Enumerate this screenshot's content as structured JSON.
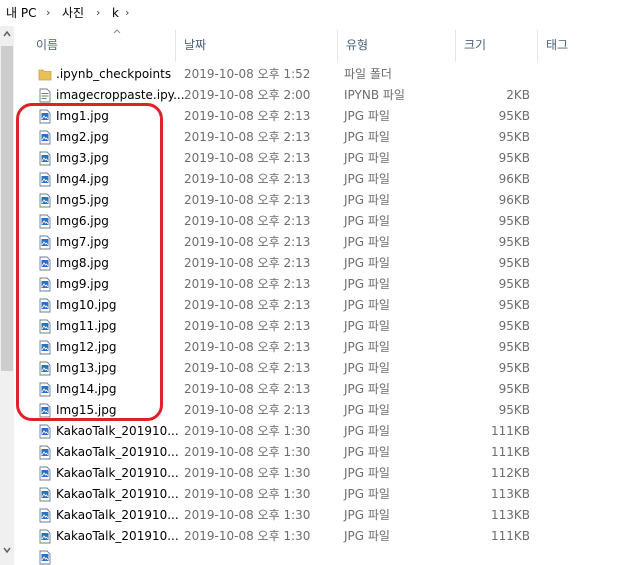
{
  "breadcrumb": [
    "내 PC",
    "사진",
    "k"
  ],
  "columns": {
    "name": "이름",
    "date": "날짜",
    "type": "유형",
    "size": "크기",
    "tags": "태그"
  },
  "files": [
    {
      "name": ".ipynb_checkpoints",
      "date": "2019-10-08 오후 1:52",
      "type": "파일 폴더",
      "size": "",
      "icon": "folder-icon"
    },
    {
      "name": "imagecroppaste.ipy...",
      "date": "2019-10-08 오후 2:00",
      "type": "IPYNB 파일",
      "size": "2KB",
      "icon": "document-icon"
    },
    {
      "name": "Img1.jpg",
      "date": "2019-10-08 오후 2:13",
      "type": "JPG 파일",
      "size": "95KB",
      "icon": "image-file-icon"
    },
    {
      "name": "Img2.jpg",
      "date": "2019-10-08 오후 2:13",
      "type": "JPG 파일",
      "size": "95KB",
      "icon": "image-file-icon"
    },
    {
      "name": "Img3.jpg",
      "date": "2019-10-08 오후 2:13",
      "type": "JPG 파일",
      "size": "95KB",
      "icon": "image-file-icon"
    },
    {
      "name": "Img4.jpg",
      "date": "2019-10-08 오후 2:13",
      "type": "JPG 파일",
      "size": "96KB",
      "icon": "image-file-icon"
    },
    {
      "name": "Img5.jpg",
      "date": "2019-10-08 오후 2:13",
      "type": "JPG 파일",
      "size": "96KB",
      "icon": "image-file-icon"
    },
    {
      "name": "Img6.jpg",
      "date": "2019-10-08 오후 2:13",
      "type": "JPG 파일",
      "size": "95KB",
      "icon": "image-file-icon"
    },
    {
      "name": "Img7.jpg",
      "date": "2019-10-08 오후 2:13",
      "type": "JPG 파일",
      "size": "95KB",
      "icon": "image-file-icon"
    },
    {
      "name": "Img8.jpg",
      "date": "2019-10-08 오후 2:13",
      "type": "JPG 파일",
      "size": "95KB",
      "icon": "image-file-icon"
    },
    {
      "name": "Img9.jpg",
      "date": "2019-10-08 오후 2:13",
      "type": "JPG 파일",
      "size": "95KB",
      "icon": "image-file-icon"
    },
    {
      "name": "Img10.jpg",
      "date": "2019-10-08 오후 2:13",
      "type": "JPG 파일",
      "size": "95KB",
      "icon": "image-file-icon"
    },
    {
      "name": "Img11.jpg",
      "date": "2019-10-08 오후 2:13",
      "type": "JPG 파일",
      "size": "95KB",
      "icon": "image-file-icon"
    },
    {
      "name": "Img12.jpg",
      "date": "2019-10-08 오후 2:13",
      "type": "JPG 파일",
      "size": "95KB",
      "icon": "image-file-icon"
    },
    {
      "name": "Img13.jpg",
      "date": "2019-10-08 오후 2:13",
      "type": "JPG 파일",
      "size": "95KB",
      "icon": "image-file-icon"
    },
    {
      "name": "Img14.jpg",
      "date": "2019-10-08 오후 2:13",
      "type": "JPG 파일",
      "size": "95KB",
      "icon": "image-file-icon"
    },
    {
      "name": "Img15.jpg",
      "date": "2019-10-08 오후 2:13",
      "type": "JPG 파일",
      "size": "95KB",
      "icon": "image-file-icon"
    },
    {
      "name": "KakaoTalk_201910...",
      "date": "2019-10-08 오후 1:30",
      "type": "JPG 파일",
      "size": "111KB",
      "icon": "image-file-icon"
    },
    {
      "name": "KakaoTalk_201910...",
      "date": "2019-10-08 오후 1:30",
      "type": "JPG 파일",
      "size": "111KB",
      "icon": "image-file-icon"
    },
    {
      "name": "KakaoTalk_201910...",
      "date": "2019-10-08 오후 1:30",
      "type": "JPG 파일",
      "size": "112KB",
      "icon": "image-file-icon"
    },
    {
      "name": "KakaoTalk_201910...",
      "date": "2019-10-08 오후 1:30",
      "type": "JPG 파일",
      "size": "113KB",
      "icon": "image-file-icon"
    },
    {
      "name": "KakaoTalk_201910...",
      "date": "2019-10-08 오후 1:30",
      "type": "JPG 파일",
      "size": "113KB",
      "icon": "image-file-icon"
    },
    {
      "name": "KakaoTalk_201910...",
      "date": "2019-10-08 오후 1:30",
      "type": "JPG 파일",
      "size": "111KB",
      "icon": "image-file-icon"
    },
    {
      "name": "",
      "date": "",
      "type": "",
      "size": "",
      "icon": "image-file-icon"
    }
  ],
  "colors": {
    "highlight": "#e0212a",
    "header_text": "#4c607a",
    "folder": "#e8c15a",
    "image_icon": "#2a6fc9"
  }
}
